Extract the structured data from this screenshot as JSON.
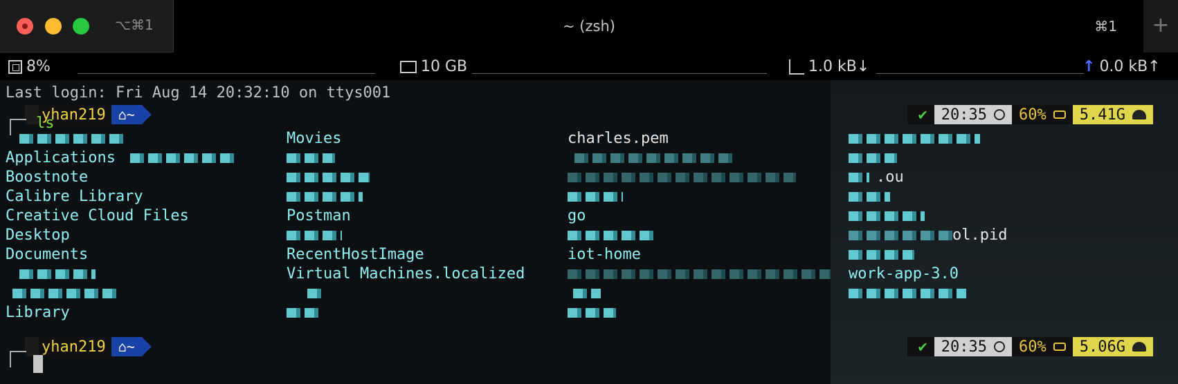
{
  "window": {
    "tab_shortcut": "⌥⌘1",
    "title": "~ (zsh)",
    "tab_number": "⌘1",
    "new_tab": "+"
  },
  "status": {
    "cpu": "8%",
    "memory": "10 GB",
    "net_down": "1.0 kB↓",
    "net_up": "0.0 kB↑"
  },
  "terminal": {
    "last_login": "Last login: Fri Aug 14 20:32:10 on ttys001",
    "prompt1": {
      "user": "yhan219",
      "dir": "~",
      "command": "ls",
      "time": "20:35",
      "battery": "60%",
      "mem": "5.41G"
    },
    "prompt2": {
      "user": "yhan219",
      "dir": "~",
      "time": "20:35",
      "battery": "60%",
      "mem": "5.06G"
    },
    "ls": {
      "col1": [
        "Applications",
        "Boostnote",
        "Calibre Library",
        "Creative Cloud Files",
        "Desktop",
        "Documents",
        "Library"
      ],
      "col2": [
        "Movies",
        "Postman",
        "RecentHostImage",
        "Virtual Machines.localized"
      ],
      "col3": [
        "charles.pem",
        "go",
        "iot-home"
      ],
      "col4": [
        "work-app-3.0",
        "ol.pid",
        ".ou"
      ]
    }
  },
  "colors": {
    "accent_user": "#f1d23f",
    "accent_dir": "#1942a8",
    "ok": "#4bd04b",
    "command": "#7ddc3c"
  }
}
